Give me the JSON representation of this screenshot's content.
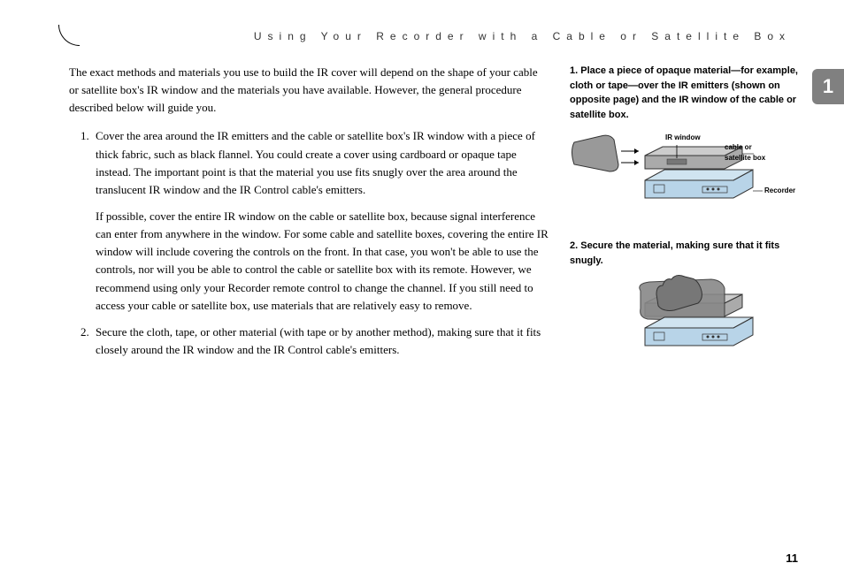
{
  "header": {
    "title": "Using Your Recorder with a Cable or Satellite Box"
  },
  "chapter": {
    "number": "1"
  },
  "main": {
    "intro": "The exact methods and materials you use to build the IR cover will depend on the shape of your cable or satellite box's IR window and the materials you have available. However, the general procedure described below will guide you.",
    "steps": [
      {
        "text": "Cover the area around the IR emitters and the cable or satellite box's IR window with a piece of thick fabric, such as black flannel. You could create a cover using cardboard or opaque tape instead. The important point is that the material you use fits snugly over the area around the translucent IR window and the IR Control cable's emitters.",
        "sub": "If possible, cover the entire IR window on the cable or satellite box, because signal interference can enter from anywhere in the window. For some cable and satellite boxes, covering the entire IR window will include covering the controls on the front. In that case, you won't be able to use the controls, nor will you be able to control the cable or satellite box with its remote. However, we recommend using only your Recorder remote control to change the channel. If you still need to access your cable or satellite box, use materials that are relatively easy to remove."
      },
      {
        "text": "Secure the cloth, tape, or other material (with tape or by another method), making sure that it fits closely around the IR window and the IR Control cable's emitters."
      }
    ]
  },
  "side": {
    "caption1": "1. Place a piece of opaque material—for example, cloth or tape—over the IR emitters (shown on opposite page) and the IR window of the cable or satellite box.",
    "caption2": "2. Secure the material, making sure that it fits snugly.",
    "labels": {
      "ir_window": "IR window",
      "cable_box": "cable or satellite box",
      "recorder": "Recorder"
    }
  },
  "page_number": "11"
}
